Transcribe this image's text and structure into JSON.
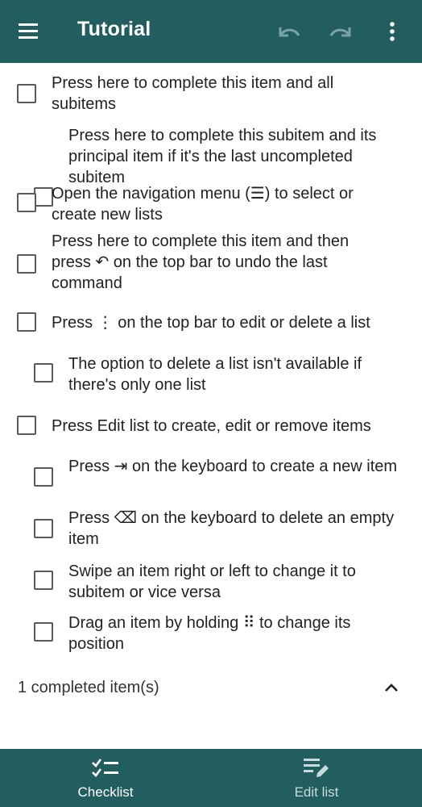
{
  "app_bar": {
    "title": "Tutorial",
    "icons": [
      "menu-icon",
      "undo-icon",
      "redo-icon",
      "more-vert-icon"
    ]
  },
  "items": [
    {
      "text": "Press here to complete this item and all subitems",
      "level": 0,
      "checked": false
    },
    {
      "text": "Press here to complete this subitem and its principal item if it's the last uncompleted subitem",
      "level": 1,
      "checked": false
    },
    {
      "text": "Open the navigation menu (☰) to select or create new lists",
      "level": 0,
      "checked": false
    },
    {
      "text": "Press here to complete this item and then press ↶ on the top bar to undo the last command",
      "level": 0,
      "checked": false
    },
    {
      "text": "Press ⋮ on the top bar to edit or delete a list",
      "level": 0,
      "checked": false
    },
    {
      "text": "The option to delete a list isn't available if there's only one list",
      "level": 1,
      "checked": false
    },
    {
      "text": "Press Edit list to create, edit or remove items",
      "level": 0,
      "checked": false
    },
    {
      "text": "Press ⇥ on the keyboard to create a new item",
      "level": 1,
      "checked": false
    },
    {
      "text": "Press ⌫ on the keyboard to delete an empty item",
      "level": 1,
      "checked": false
    },
    {
      "text": "Swipe an item right or left to change it to subitem or vice versa",
      "level": 1,
      "checked": false
    },
    {
      "text": "Drag an item by holding ⠿ to change its position",
      "level": 1,
      "checked": false
    }
  ],
  "completed_section": {
    "label": "1 completed item(s)",
    "expanded": true
  },
  "bottom_nav": {
    "tabs": [
      {
        "label": "Checklist",
        "active": true,
        "icon": "checklist-icon"
      },
      {
        "label": "Edit list",
        "active": false,
        "icon": "edit-list-icon"
      }
    ]
  },
  "colors": {
    "primary": "#225e60",
    "checkbox": "#5a5a5a",
    "inactive_tab": "#c8dad9"
  }
}
